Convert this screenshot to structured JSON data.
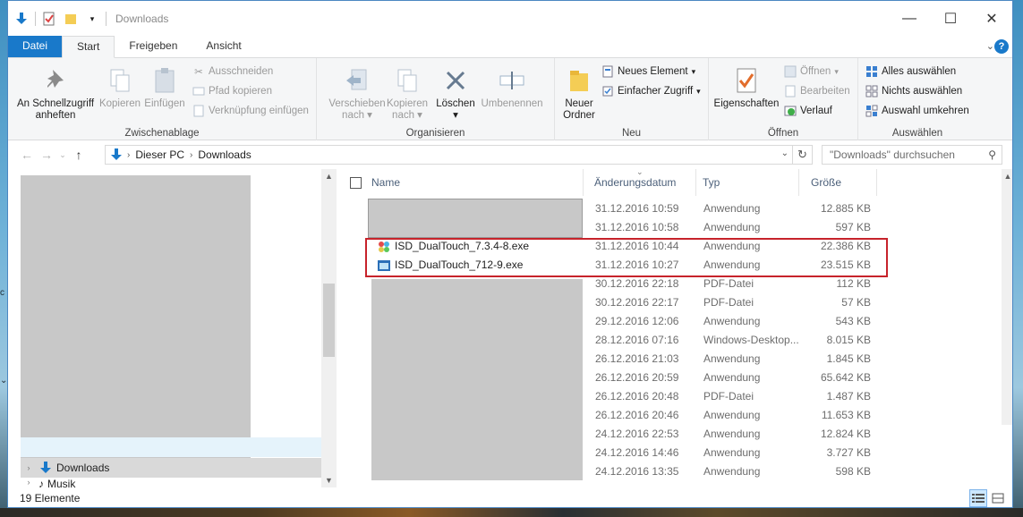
{
  "window": {
    "title": "Downloads"
  },
  "tabs": [
    {
      "label": "Datei"
    },
    {
      "label": "Start"
    },
    {
      "label": "Freigeben"
    },
    {
      "label": "Ansicht"
    }
  ],
  "ribbon": {
    "clipboard": {
      "label": "Zwischenablage",
      "pin": "An Schnellzugriff anheften",
      "copy": "Kopieren",
      "paste": "Einfügen",
      "cut": "Ausschneiden",
      "copy_path": "Pfad kopieren",
      "paste_shortcut": "Verknüpfung einfügen"
    },
    "organize": {
      "label": "Organisieren",
      "move_to": "Verschieben nach",
      "copy_to": "Kopieren nach",
      "delete": "Löschen",
      "rename": "Umbenennen"
    },
    "new": {
      "label": "Neu",
      "new_folder": "Neuer Ordner",
      "new_item": "Neues Element",
      "easy_access": "Einfacher Zugriff"
    },
    "open": {
      "label": "Öffnen",
      "properties": "Eigenschaften",
      "open": "Öffnen",
      "edit": "Bearbeiten",
      "history": "Verlauf"
    },
    "select": {
      "label": "Auswählen",
      "select_all": "Alles auswählen",
      "select_none": "Nichts auswählen",
      "invert": "Auswahl umkehren"
    }
  },
  "address": {
    "crumbs": [
      "Dieser PC",
      "Downloads"
    ],
    "search_placeholder": "\"Downloads\" durchsuchen"
  },
  "nav": {
    "items": [
      {
        "label": "Downloads"
      },
      {
        "label": "Musik"
      }
    ]
  },
  "columns": {
    "name": "Name",
    "date": "Änderungsdatum",
    "type": "Typ",
    "size": "Größe"
  },
  "files": [
    {
      "name": "",
      "date": "31.12.2016 10:59",
      "type": "Anwendung",
      "size": "12.885 KB"
    },
    {
      "name": "",
      "date": "31.12.2016 10:58",
      "type": "Anwendung",
      "size": "597 KB"
    },
    {
      "name": "ISD_DualTouch_7.3.4-8.exe",
      "date": "31.12.2016 10:44",
      "type": "Anwendung",
      "size": "22.386 KB"
    },
    {
      "name": "ISD_DualTouch_712-9.exe",
      "date": "31.12.2016 10:27",
      "type": "Anwendung",
      "size": "23.515 KB"
    },
    {
      "name": "",
      "date": "30.12.2016 22:18",
      "type": "PDF-Datei",
      "size": "112 KB"
    },
    {
      "name": "",
      "date": "30.12.2016 22:17",
      "type": "PDF-Datei",
      "size": "57 KB"
    },
    {
      "name": "",
      "date": "29.12.2016 12:06",
      "type": "Anwendung",
      "size": "543 KB"
    },
    {
      "name": "",
      "date": "28.12.2016 07:16",
      "type": "Windows-Desktop...",
      "size": "8.015 KB"
    },
    {
      "name": "",
      "date": "26.12.2016 21:03",
      "type": "Anwendung",
      "size": "1.845 KB"
    },
    {
      "name": "",
      "date": "26.12.2016 20:59",
      "type": "Anwendung",
      "size": "65.642 KB"
    },
    {
      "name": "",
      "date": "26.12.2016 20:48",
      "type": "PDF-Datei",
      "size": "1.487 KB"
    },
    {
      "name": "",
      "date": "26.12.2016 20:46",
      "type": "Anwendung",
      "size": "11.653 KB"
    },
    {
      "name": "",
      "date": "24.12.2016 22:53",
      "type": "Anwendung",
      "size": "12.824 KB"
    },
    {
      "name": "",
      "date": "24.12.2016 14:46",
      "type": "Anwendung",
      "size": "3.727 KB"
    },
    {
      "name": "",
      "date": "24.12.2016 13:35",
      "type": "Anwendung",
      "size": "598 KB"
    }
  ],
  "status": {
    "count": "19 Elemente"
  },
  "colors": {
    "accent": "#1979ca",
    "highlight_box": "#c7232b"
  }
}
